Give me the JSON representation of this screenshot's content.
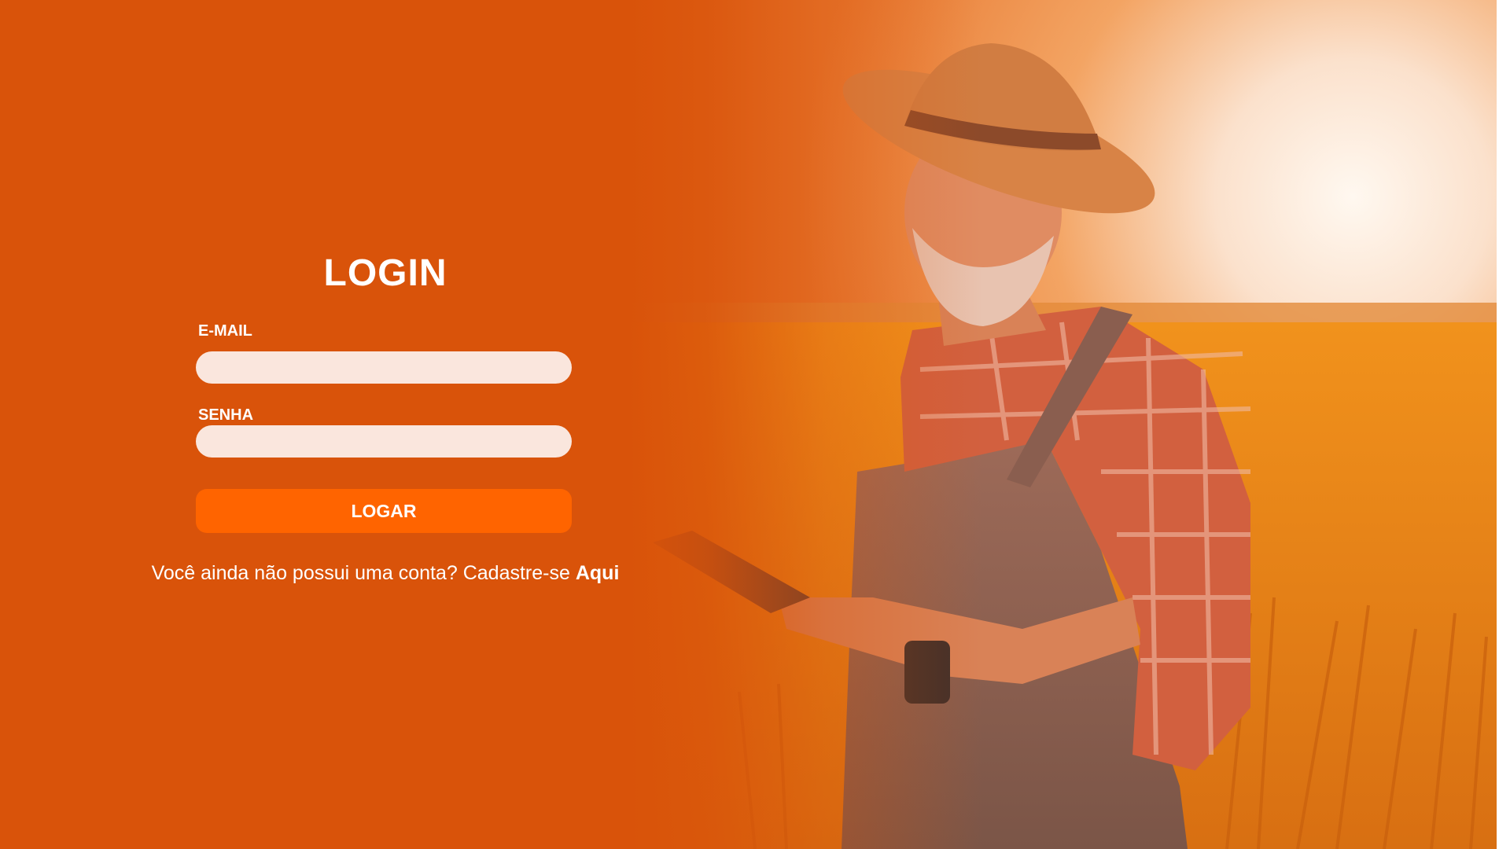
{
  "login": {
    "title": "LOGIN",
    "email_label": "E-MAIL",
    "email_value": "",
    "password_label": "SENHA",
    "password_value": "",
    "submit_label": "LOGAR",
    "signup_text": "Você ainda não possui uma conta? Cadastre-se",
    "signup_link": "Aqui"
  },
  "colors": {
    "background": "#d9530a",
    "input_bg": "#fae6dd",
    "button": "#ff6400",
    "text": "#ffffff"
  },
  "hero_image": {
    "icon": "farmer-with-tablet-in-wheat-field"
  }
}
